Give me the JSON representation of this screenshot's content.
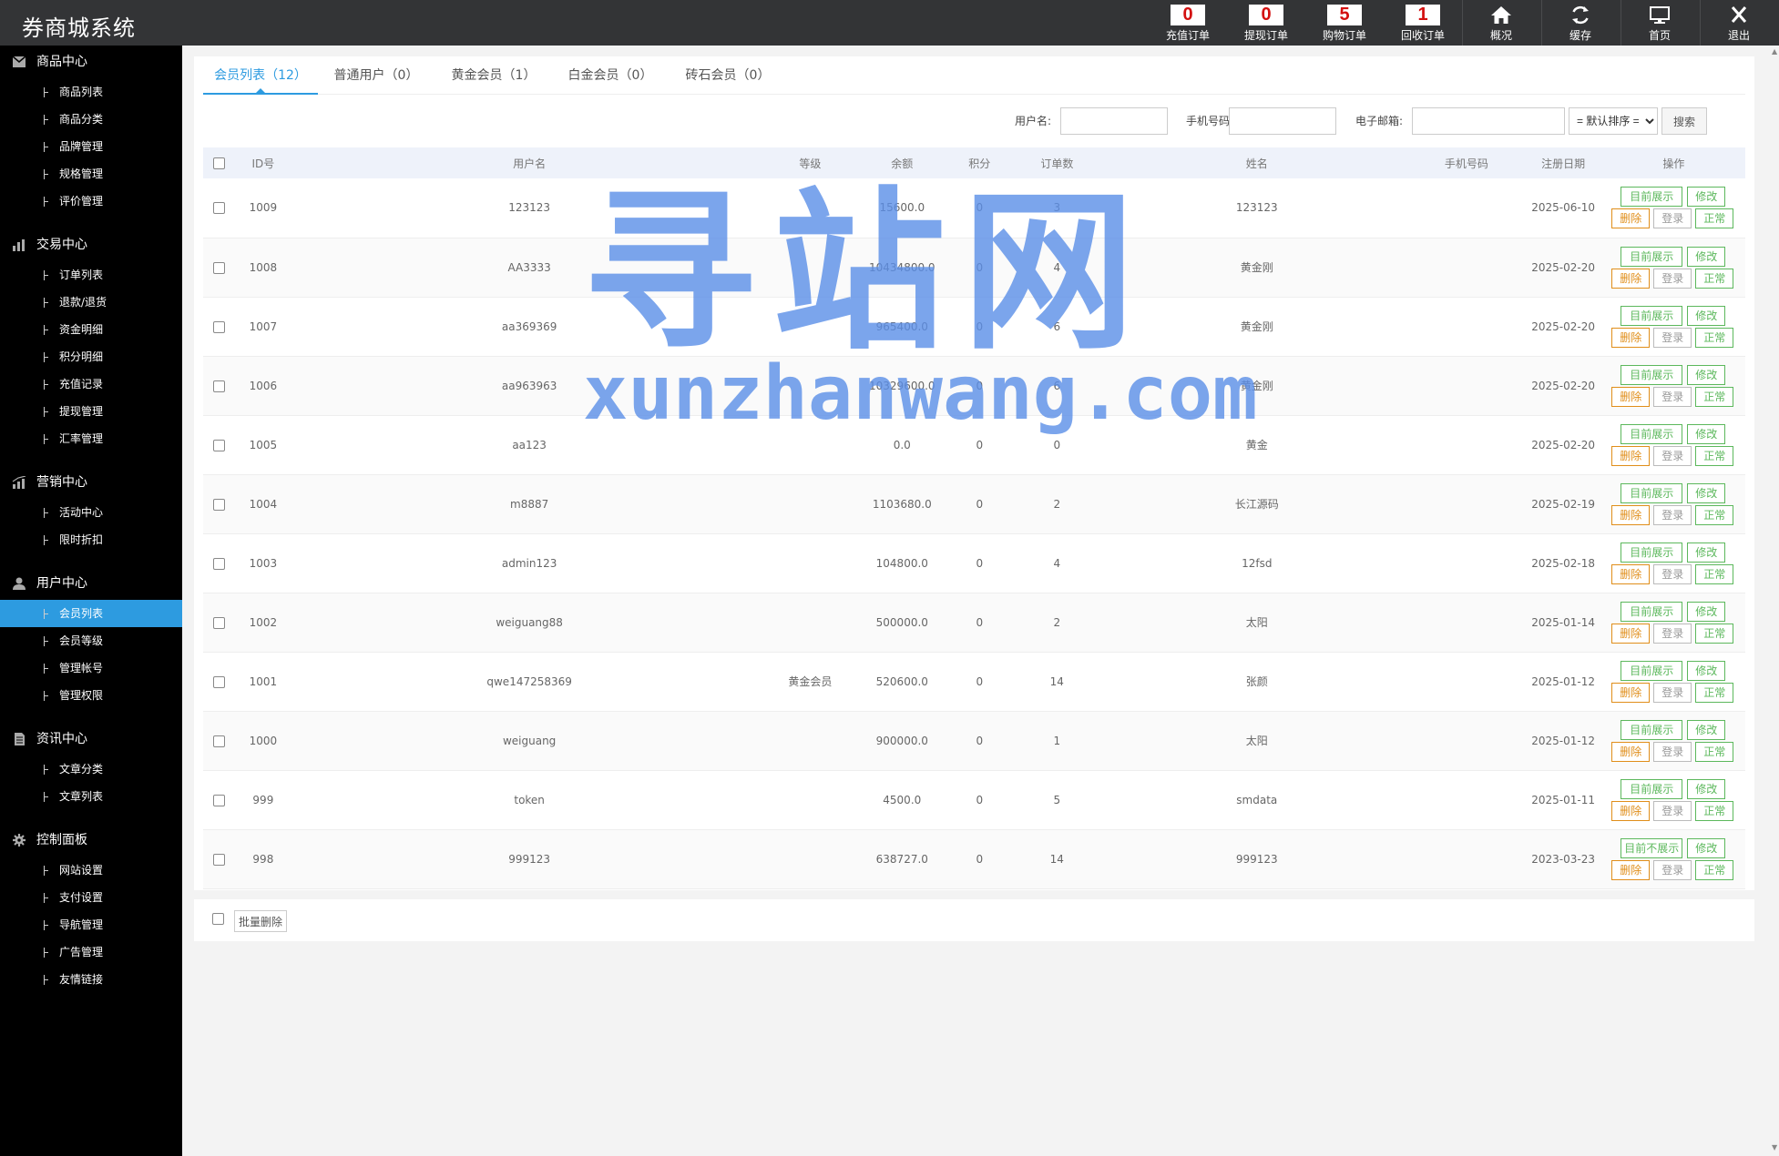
{
  "app": {
    "title": "券商城系统"
  },
  "topbar": {
    "counters": [
      {
        "count": "0",
        "label": "充值订单"
      },
      {
        "count": "0",
        "label": "提现订单"
      },
      {
        "count": "5",
        "label": "购物订单"
      },
      {
        "count": "1",
        "label": "回收订单"
      }
    ],
    "icons": [
      {
        "icon": "home-icon",
        "label": "概况"
      },
      {
        "icon": "refresh-icon",
        "label": "缓存"
      },
      {
        "icon": "monitor-icon",
        "label": "首页"
      },
      {
        "icon": "close-icon",
        "label": "退出"
      }
    ]
  },
  "sidebar": {
    "sections": [
      {
        "title": "商品中心",
        "icon": "envelope-icon",
        "items": [
          "商品列表",
          "商品分类",
          "品牌管理",
          "规格管理",
          "评价管理"
        ]
      },
      {
        "title": "交易中心",
        "icon": "bar-chart-icon",
        "items": [
          "订单列表",
          "退款/退货",
          "资金明细",
          "积分明细",
          "充值记录",
          "提现管理",
          "汇率管理"
        ]
      },
      {
        "title": "营销中心",
        "icon": "growth-chart-icon",
        "items": [
          "活动中心",
          "限时折扣"
        ]
      },
      {
        "title": "用户中心",
        "icon": "user-icon",
        "items": [
          "会员列表",
          "会员等级",
          "管理帐号",
          "管理权限"
        ]
      },
      {
        "title": "资讯中心",
        "icon": "document-icon",
        "items": [
          "文章分类",
          "文章列表"
        ]
      },
      {
        "title": "控制面板",
        "icon": "gear-icon",
        "items": [
          "网站设置",
          "支付设置",
          "导航管理",
          "广告管理",
          "友情链接"
        ]
      }
    ],
    "active_item": "会员列表"
  },
  "tabs": [
    "会员列表（12）",
    "普通用户（0）",
    "黄金会员（1）",
    "白金会员（0）",
    "砖石会员（0）"
  ],
  "search": {
    "username_label": "用户名:",
    "phone_label": "手机号码:",
    "email_label": "电子邮箱:",
    "sort_selected": "= 默认排序 =",
    "search_button": "搜索"
  },
  "table": {
    "headers": [
      "ID号",
      "用户名",
      "等级",
      "余额",
      "积分",
      "订单数",
      "姓名",
      "手机号码",
      "注册日期",
      "操作"
    ],
    "rows": [
      {
        "id": "1009",
        "username": "123123",
        "level": "",
        "balance": "15600.0",
        "points": "0",
        "orders": "3",
        "name": "123123",
        "phone": "",
        "date": "2025-06-10",
        "show": "目前展示"
      },
      {
        "id": "1008",
        "username": "AA3333",
        "level": "",
        "balance": "10434800.0",
        "points": "0",
        "orders": "4",
        "name": "黄金刚",
        "phone": "",
        "date": "2025-02-20",
        "show": "目前展示"
      },
      {
        "id": "1007",
        "username": "aa369369",
        "level": "",
        "balance": "965400.0",
        "points": "0",
        "orders": "6",
        "name": "黄金刚",
        "phone": "",
        "date": "2025-02-20",
        "show": "目前展示"
      },
      {
        "id": "1006",
        "username": "aa963963",
        "level": "",
        "balance": "10329600.0",
        "points": "0",
        "orders": "6",
        "name": "黄金刚",
        "phone": "",
        "date": "2025-02-20",
        "show": "目前展示"
      },
      {
        "id": "1005",
        "username": "aa123",
        "level": "",
        "balance": "0.0",
        "points": "0",
        "orders": "0",
        "name": "黄金",
        "phone": "",
        "date": "2025-02-20",
        "show": "目前展示"
      },
      {
        "id": "1004",
        "username": "m8887",
        "level": "",
        "balance": "1103680.0",
        "points": "0",
        "orders": "2",
        "name": "长江源码",
        "phone": "",
        "date": "2025-02-19",
        "show": "目前展示"
      },
      {
        "id": "1003",
        "username": "admin123",
        "level": "",
        "balance": "104800.0",
        "points": "0",
        "orders": "4",
        "name": "12fsd",
        "phone": "",
        "date": "2025-02-18",
        "show": "目前展示"
      },
      {
        "id": "1002",
        "username": "weiguang88",
        "level": "",
        "balance": "500000.0",
        "points": "0",
        "orders": "2",
        "name": "太阳",
        "phone": "",
        "date": "2025-01-14",
        "show": "目前展示"
      },
      {
        "id": "1001",
        "username": "qwe147258369",
        "level": "黄金会员",
        "balance": "520600.0",
        "points": "0",
        "orders": "14",
        "name": "张颜",
        "phone": "",
        "date": "2025-01-12",
        "show": "目前展示"
      },
      {
        "id": "1000",
        "username": "weiguang",
        "level": "",
        "balance": "900000.0",
        "points": "0",
        "orders": "1",
        "name": "太阳",
        "phone": "",
        "date": "2025-01-12",
        "show": "目前展示"
      },
      {
        "id": "999",
        "username": "token",
        "level": "",
        "balance": "4500.0",
        "points": "0",
        "orders": "5",
        "name": "smdata",
        "phone": "",
        "date": "2025-01-11",
        "show": "目前展示"
      },
      {
        "id": "998",
        "username": "999123",
        "level": "",
        "balance": "638727.0",
        "points": "0",
        "orders": "14",
        "name": "999123",
        "phone": "",
        "date": "2023-03-23",
        "show": "目前不展示"
      }
    ],
    "actions": {
      "edit": "修改",
      "delete": "删除",
      "login": "登录",
      "status": "正常"
    }
  },
  "footer": {
    "batch_delete": "批量删除"
  },
  "watermark": {
    "main": "寻站网",
    "sub": "xunzhanwang.com"
  },
  "colors": {
    "topbar": "#333436",
    "sidebar": "#000000",
    "accent": "#2d9be0",
    "balance": "#e37b21",
    "orders": "#3a6fc9",
    "green_button": "#5cb85c",
    "orange_button": "#e08e1a",
    "watermark": "#5b8fe8"
  }
}
